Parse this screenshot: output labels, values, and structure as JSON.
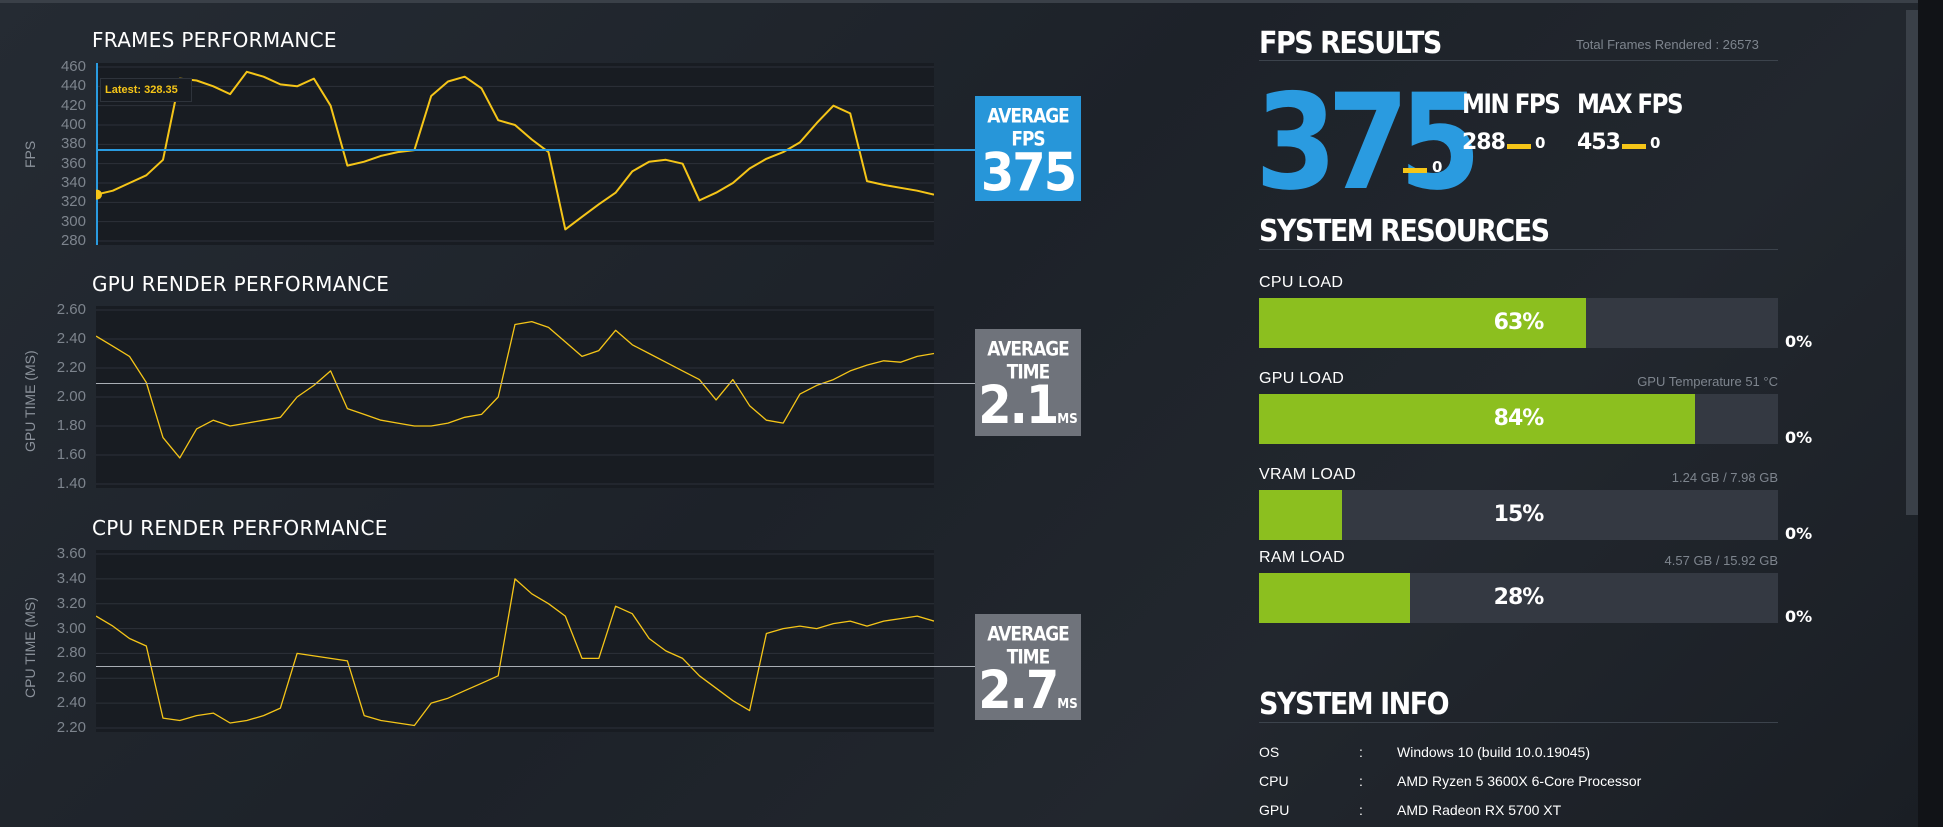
{
  "fps_chart": {
    "title": "FRAMES PERFORMANCE",
    "ylabel": "FPS",
    "yticks": [
      "460",
      "440",
      "420",
      "400",
      "380",
      "360",
      "340",
      "320",
      "300",
      "280"
    ],
    "latest_label": "Latest: 328.35",
    "average_label": "AVERAGE FPS",
    "average_value": "375",
    "average_unit": ""
  },
  "gpu_chart": {
    "title": "GPU RENDER PERFORMANCE",
    "ylabel": "GPU TIME (MS)",
    "yticks": [
      "2.60",
      "2.40",
      "2.20",
      "2.00",
      "1.80",
      "1.60",
      "1.40"
    ],
    "average_label": "AVERAGE TIME",
    "average_value": "2.1",
    "average_unit": "MS"
  },
  "cpu_chart": {
    "title": "CPU RENDER PERFORMANCE",
    "ylabel": "CPU TIME (MS)",
    "yticks": [
      "3.60",
      "3.40",
      "3.20",
      "3.00",
      "2.80",
      "2.60",
      "2.40",
      "2.20"
    ],
    "average_label": "AVERAGE TIME",
    "average_value": "2.7",
    "average_unit": "MS"
  },
  "fps_results": {
    "title": "FPS RESULTS",
    "total_frames": "Total Frames Rendered : 26573",
    "average": "375",
    "average_delta": "0",
    "min_label": "MIN FPS",
    "min_value": "288",
    "min_delta": "0",
    "max_label": "MAX FPS",
    "max_value": "453",
    "max_delta": "0"
  },
  "system_resources": {
    "title": "SYSTEM RESOURCES",
    "items": [
      {
        "label": "CPU LOAD",
        "detail": "",
        "percent": "63%",
        "fraction": 0.63,
        "delta": "0%"
      },
      {
        "label": "GPU LOAD",
        "detail": "GPU Temperature 51 °C",
        "percent": "84%",
        "fraction": 0.84,
        "delta": "0%"
      },
      {
        "label": "VRAM LOAD",
        "detail": "1.24 GB / 7.98 GB",
        "percent": "15%",
        "fraction": 0.16,
        "delta": "0%"
      },
      {
        "label": "RAM LOAD",
        "detail": "4.57 GB / 15.92 GB",
        "percent": "28%",
        "fraction": 0.29,
        "delta": "0%"
      }
    ]
  },
  "system_info": {
    "title": "SYSTEM INFO",
    "rows": [
      {
        "key": "OS",
        "sep": ":",
        "value": "Windows 10 (build 10.0.19045)"
      },
      {
        "key": "CPU",
        "sep": ":",
        "value": "AMD Ryzen 5 3600X 6-Core Processor"
      },
      {
        "key": "GPU",
        "sep": ":",
        "value": "AMD Radeon RX 5700 XT"
      }
    ]
  },
  "colors": {
    "accent_blue": "#2a9be0",
    "series_yellow": "#f5c518",
    "load_green": "#8cbf1f"
  },
  "chart_data": [
    {
      "type": "line",
      "title": "FRAMES PERFORMANCE",
      "ylabel": "FPS",
      "ylim": [
        280,
        460
      ],
      "average": 375,
      "x": [
        0,
        2,
        4,
        6,
        8,
        10,
        12,
        14,
        16,
        18,
        20,
        22,
        24,
        26,
        28,
        30,
        32,
        34,
        36,
        38,
        40,
        42,
        44,
        46,
        48,
        50,
        52,
        54,
        56,
        58,
        60,
        62,
        64,
        66,
        68,
        70,
        72,
        74,
        76,
        78,
        80,
        82,
        84,
        86,
        88,
        90,
        92,
        94,
        96,
        98,
        100
      ],
      "y": [
        328,
        332,
        340,
        348,
        364,
        448,
        446,
        440,
        432,
        455,
        450,
        442,
        440,
        448,
        420,
        358,
        362,
        368,
        372,
        374,
        430,
        445,
        450,
        438,
        405,
        400,
        385,
        372,
        292,
        305,
        318,
        330,
        352,
        362,
        364,
        360,
        322,
        330,
        340,
        355,
        365,
        372,
        382,
        402,
        420,
        412,
        342,
        338,
        335,
        332,
        328
      ]
    },
    {
      "type": "line",
      "title": "GPU RENDER PERFORMANCE",
      "ylabel": "GPU TIME (MS)",
      "ylim": [
        1.4,
        2.6
      ],
      "average": 2.1,
      "x": [
        0,
        2,
        4,
        6,
        8,
        10,
        12,
        14,
        16,
        18,
        20,
        22,
        24,
        26,
        28,
        30,
        32,
        34,
        36,
        38,
        40,
        42,
        44,
        46,
        48,
        50,
        52,
        54,
        56,
        58,
        60,
        62,
        64,
        66,
        68,
        70,
        72,
        74,
        76,
        78,
        80,
        82,
        84,
        86,
        88,
        90,
        92,
        94,
        96,
        98,
        100
      ],
      "y": [
        2.42,
        2.35,
        2.28,
        2.1,
        1.72,
        1.58,
        1.78,
        1.84,
        1.8,
        1.82,
        1.84,
        1.86,
        2.0,
        2.08,
        2.18,
        1.92,
        1.88,
        1.84,
        1.82,
        1.8,
        1.8,
        1.82,
        1.86,
        1.88,
        2.0,
        2.5,
        2.52,
        2.48,
        2.38,
        2.28,
        2.32,
        2.46,
        2.36,
        2.3,
        2.24,
        2.18,
        2.12,
        1.98,
        2.12,
        1.94,
        1.84,
        1.82,
        2.02,
        2.08,
        2.12,
        2.18,
        2.22,
        2.25,
        2.24,
        2.28,
        2.3
      ]
    },
    {
      "type": "line",
      "title": "CPU RENDER PERFORMANCE",
      "ylabel": "CPU TIME (MS)",
      "ylim": [
        2.2,
        3.6
      ],
      "average": 2.7,
      "x": [
        0,
        2,
        4,
        6,
        8,
        10,
        12,
        14,
        16,
        18,
        20,
        22,
        24,
        26,
        28,
        30,
        32,
        34,
        36,
        38,
        40,
        42,
        44,
        46,
        48,
        50,
        52,
        54,
        56,
        58,
        60,
        62,
        64,
        66,
        68,
        70,
        72,
        74,
        76,
        78,
        80,
        82,
        84,
        86,
        88,
        90,
        92,
        94,
        96,
        98,
        100
      ],
      "y": [
        3.1,
        3.02,
        2.92,
        2.86,
        2.28,
        2.26,
        2.3,
        2.32,
        2.24,
        2.26,
        2.3,
        2.36,
        2.8,
        2.78,
        2.76,
        2.74,
        2.3,
        2.26,
        2.24,
        2.22,
        2.4,
        2.44,
        2.5,
        2.56,
        2.62,
        3.4,
        3.28,
        3.2,
        3.1,
        2.76,
        2.76,
        3.18,
        3.12,
        2.92,
        2.82,
        2.76,
        2.62,
        2.52,
        2.42,
        2.34,
        2.96,
        3.0,
        3.02,
        3.0,
        3.04,
        3.06,
        3.02,
        3.06,
        3.08,
        3.1,
        3.06
      ]
    }
  ]
}
